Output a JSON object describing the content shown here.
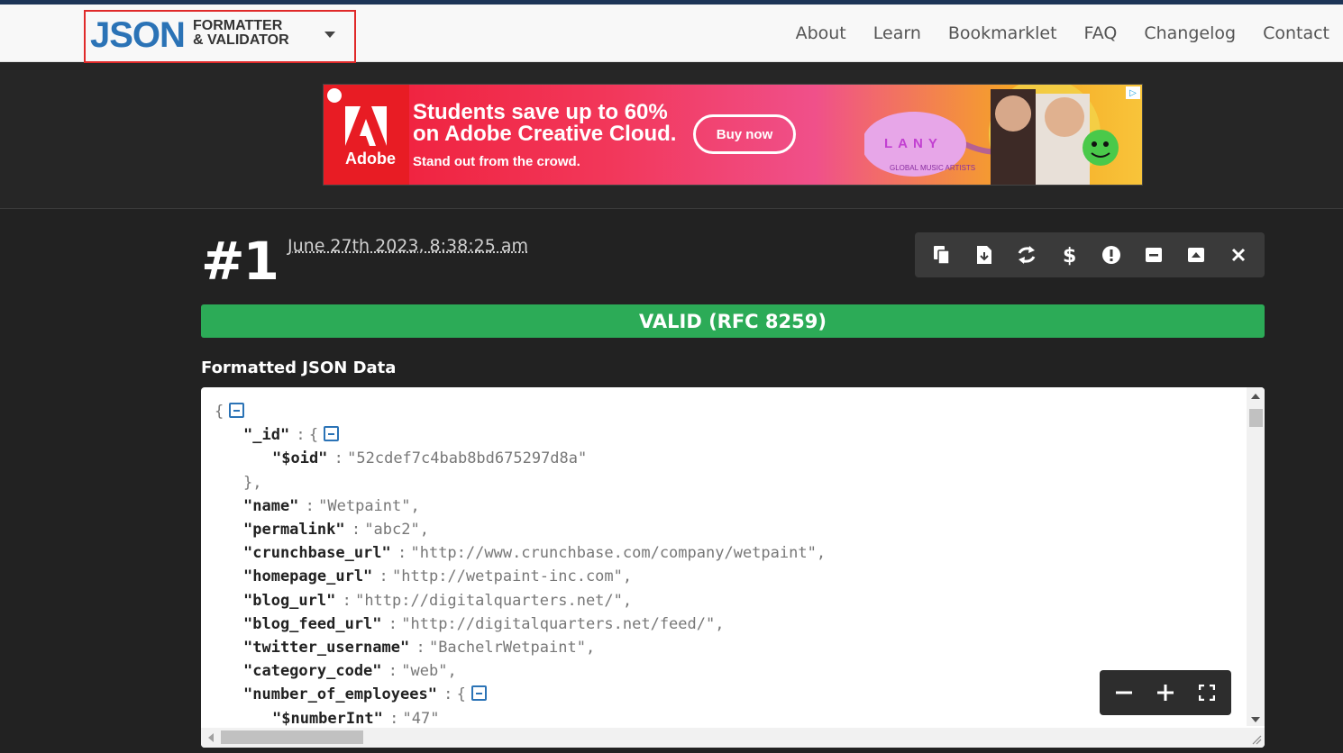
{
  "brand": {
    "logo_main": "JSON",
    "logo_line1": "FORMATTER",
    "logo_line2": "& VALIDATOR"
  },
  "nav": {
    "items": [
      {
        "label": "About"
      },
      {
        "label": "Learn"
      },
      {
        "label": "Bookmarklet"
      },
      {
        "label": "FAQ"
      },
      {
        "label": "Changelog"
      },
      {
        "label": "Contact"
      }
    ]
  },
  "ad": {
    "brand": "Adobe",
    "headline_line1": "Students save up to 60%",
    "headline_line2": "on Adobe Creative Cloud.",
    "tagline": "Stand out from the crowd.",
    "cta": "Buy now",
    "artist": "LANY",
    "artist_sub": "GLOBAL MUSIC ARTISTS"
  },
  "result": {
    "number": "#1",
    "timestamp": "June 27th 2023, 8:38:25 am",
    "status": "VALID (RFC 8259)",
    "status_color": "#2cab57",
    "section_title": "Formatted JSON Data"
  },
  "toolbar": {
    "icons": [
      "copy-icon",
      "download-icon",
      "refresh-icon",
      "dollar-icon",
      "alert-icon",
      "collapse-icon",
      "expand-icon",
      "close-icon"
    ]
  },
  "zoom": {
    "icons": [
      "zoom-out-icon",
      "zoom-in-icon",
      "fullscreen-icon"
    ]
  },
  "json_lines": [
    {
      "indent": 0,
      "text": "{",
      "fold": true
    },
    {
      "indent": 1,
      "key": "\"_id\"",
      "value": "{",
      "fold": true,
      "raw_value": true
    },
    {
      "indent": 2,
      "key": "\"$oid\"",
      "value": "\"52cdef7c4bab8bd675297d8a\""
    },
    {
      "indent": 1,
      "text": "},"
    },
    {
      "indent": 1,
      "key": "\"name\"",
      "value": "\"Wetpaint\"",
      "comma": true
    },
    {
      "indent": 1,
      "key": "\"permalink\"",
      "value": "\"abc2\"",
      "comma": true
    },
    {
      "indent": 1,
      "key": "\"crunchbase_url\"",
      "value": "\"http://www.crunchbase.com/company/wetpaint\"",
      "comma": true
    },
    {
      "indent": 1,
      "key": "\"homepage_url\"",
      "value": "\"http://wetpaint-inc.com\"",
      "comma": true
    },
    {
      "indent": 1,
      "key": "\"blog_url\"",
      "value": "\"http://digitalquarters.net/\"",
      "comma": true
    },
    {
      "indent": 1,
      "key": "\"blog_feed_url\"",
      "value": "\"http://digitalquarters.net/feed/\"",
      "comma": true
    },
    {
      "indent": 1,
      "key": "\"twitter_username\"",
      "value": "\"BachelrWetpaint\"",
      "comma": true
    },
    {
      "indent": 1,
      "key": "\"category_code\"",
      "value": "\"web\"",
      "comma": true
    },
    {
      "indent": 1,
      "key": "\"number_of_employees\"",
      "value": "{",
      "fold": true,
      "raw_value": true
    },
    {
      "indent": 2,
      "key": "\"$numberInt\"",
      "value": "\"47\""
    }
  ]
}
